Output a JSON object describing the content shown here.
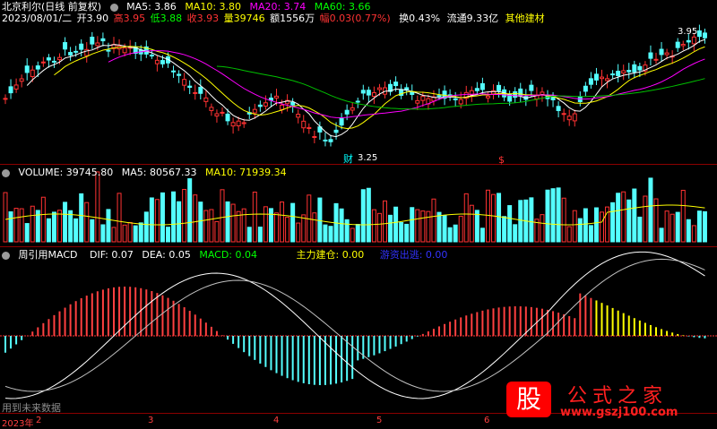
{
  "header": {
    "stock": "北京利尔(日线 前复权)",
    "ma5": "MA5: 3.86",
    "ma10": "MA10: 3.80",
    "ma20": "MA20: 3.74",
    "ma60": "MA60: 3.66",
    "quote_date": "2023/08/01/二",
    "open": "开3.90",
    "high": "高3.95",
    "low": "低3.88",
    "close": "收3.93",
    "volume": "量39746",
    "amount": "额1556万",
    "change": "幅0.03(0.77%)",
    "turnover": "换0.43%",
    "float_cap": "流通9.33亿",
    "sector": "其他建材"
  },
  "price_labels": {
    "high_mark": "3.95",
    "low_mark": "3.25",
    "cai": "财",
    "s_mark": "$"
  },
  "volume_panel": {
    "title": "VOLUME: 39745.80",
    "ma5": "MA5: 80567.33",
    "ma10": "MA10: 71939.34"
  },
  "macd_panel": {
    "name": "周引用MACD",
    "dif": "DIF: 0.07",
    "dea": "DEA: 0.05",
    "macd": "MACD: 0.04",
    "build": "主力建仓: 0.00",
    "flee": "游资出逃: 0.00",
    "watermark": "用到未来数据"
  },
  "timeline": {
    "y2023": "2023年",
    "m2": "2",
    "m3": "3",
    "m4": "4",
    "m5": "5",
    "m6": "6"
  },
  "logo": {
    "glyph": "股",
    "title": "公式之家",
    "url": "www.gszj100.com"
  },
  "colors": {
    "up": "#ff3232",
    "down": "#54ffff",
    "ma5": "#ffffff",
    "ma10": "#ffff00",
    "ma20": "#ff00ff",
    "ma60": "#00c000"
  }
}
